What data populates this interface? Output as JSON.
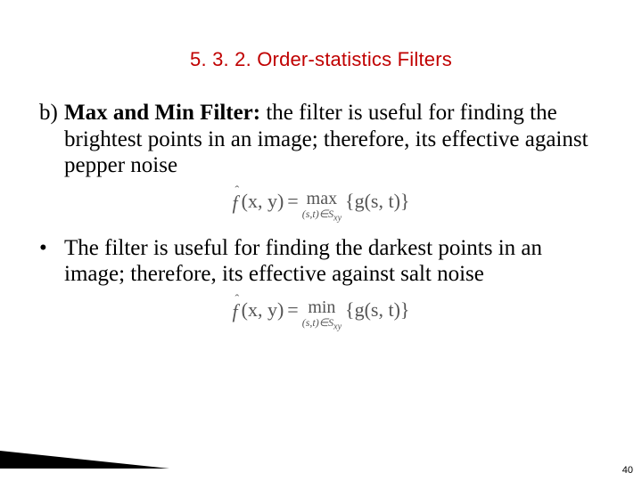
{
  "title": "5. 3. 2. Order-statistics Filters",
  "item_b": {
    "label": "b)",
    "heading": "Max and Min Filter:",
    "text": " the filter is useful for finding the brightest points in an image; therefore, its effective against pepper noise"
  },
  "formula_max": {
    "lhs_f": "f",
    "lhs_hat": "ˆ",
    "lhs_args": "(x, y)",
    "eq": " = ",
    "op": "max",
    "op_sub": "(s,t)∈S",
    "op_sub_ss": "xy",
    "rhs": " {g(s, t)}"
  },
  "bullet2": {
    "dot": "•",
    "text": "The filter is useful for finding the darkest points in an image; therefore, its effective against salt noise"
  },
  "formula_min": {
    "lhs_f": "f",
    "lhs_hat": "ˆ",
    "lhs_args": "(x, y)",
    "eq": " = ",
    "op": "min",
    "op_sub": "(s,t)∈S",
    "op_sub_ss": "xy",
    "rhs": " {g(s, t)}"
  },
  "page_number": "40"
}
